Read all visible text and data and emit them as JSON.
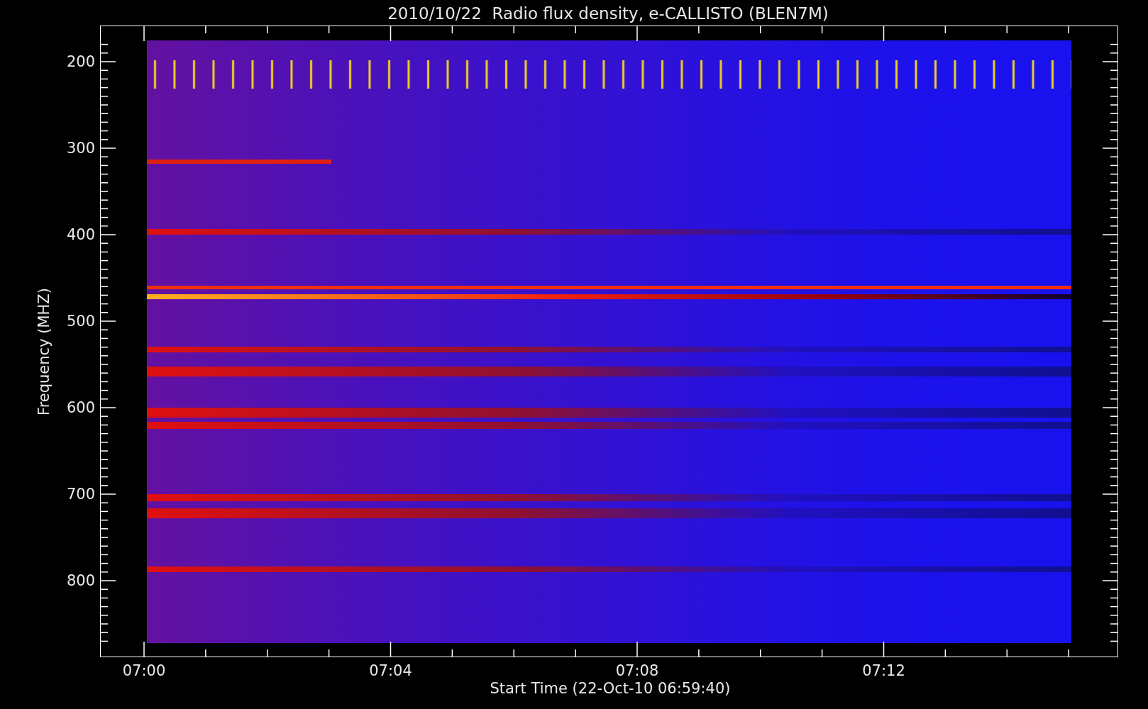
{
  "title": "2010/10/22  Radio flux density, e-CALLISTO (BLEN7M)",
  "y_axis": {
    "label": "Frequency (MHZ)",
    "ticks": [
      "200",
      "300",
      "400",
      "500",
      "600",
      "700",
      "800"
    ]
  },
  "x_axis": {
    "label": "Start Time (22-Oct-10 06:59:40)",
    "ticks": [
      "07:00",
      "07:04",
      "07:08",
      "07:12"
    ]
  }
}
